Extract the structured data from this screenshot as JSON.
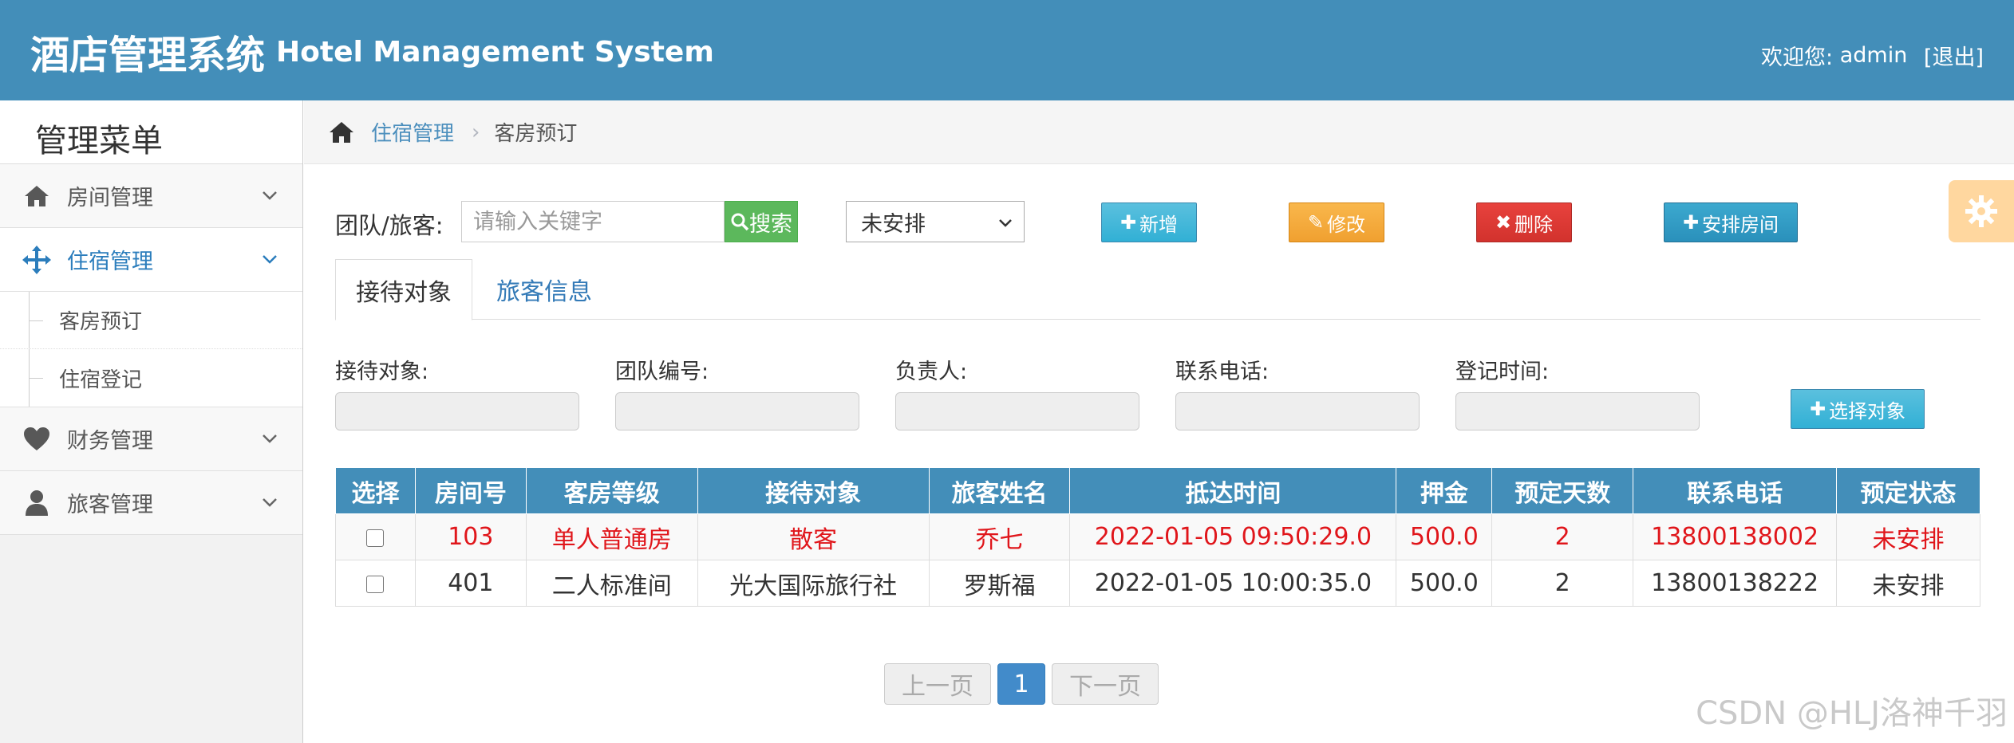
{
  "header": {
    "title_cn": "酒店管理系统",
    "title_en": "Hotel Management System",
    "welcome_label": "欢迎您:",
    "username": "admin",
    "logout_label": "[退出]"
  },
  "sidebar": {
    "title": "管理菜单",
    "items": [
      {
        "label": "房间管理",
        "icon": "home-icon"
      },
      {
        "label": "住宿管理",
        "icon": "move-icon"
      },
      {
        "label": "财务管理",
        "icon": "heart-icon"
      },
      {
        "label": "旅客管理",
        "icon": "user-icon"
      }
    ],
    "subitems": [
      {
        "label": "客房预订"
      },
      {
        "label": "住宿登记"
      }
    ]
  },
  "breadcrumb": {
    "parent": "住宿管理",
    "current": "客房预订"
  },
  "toolbar": {
    "search_label": "团队/旅客:",
    "search_placeholder": "请输入关键字",
    "search_button": "搜索",
    "status_selected": "未安排",
    "add_label": "新增",
    "edit_label": "修改",
    "delete_label": "删除",
    "assign_label": "安排房间"
  },
  "tabs": [
    "接待对象",
    "旅客信息"
  ],
  "form": {
    "fields": [
      "接待对象:",
      "团队编号:",
      "负责人:",
      "联系电话:",
      "登记时间:"
    ],
    "choose_button": "选择对象"
  },
  "table": {
    "headers": [
      "选择",
      "房间号",
      "客房等级",
      "接待对象",
      "旅客姓名",
      "抵达时间",
      "押金",
      "预定天数",
      "联系电话",
      "预定状态"
    ],
    "rows": [
      [
        "103",
        "单人普通房",
        "散客",
        "乔七",
        "2022-01-05 09:50:29.0",
        "500.0",
        "2",
        "13800138002",
        "未安排"
      ],
      [
        "401",
        "二人标准间",
        "光大国际旅行社",
        "罗斯福",
        "2022-01-05 10:00:35.0",
        "500.0",
        "2",
        "13800138222",
        "未安排"
      ]
    ]
  },
  "pager": {
    "prev": "上一页",
    "current": "1",
    "next": "下一页"
  },
  "watermark": "CSDN @HLJ洛神千羽",
  "colors": {
    "header_bg": "#438eb9",
    "highlight_row_text": "#e0161b",
    "search_button": "#5cb85c",
    "edit_button": "#f0a030",
    "delete_button": "#d2322d"
  }
}
